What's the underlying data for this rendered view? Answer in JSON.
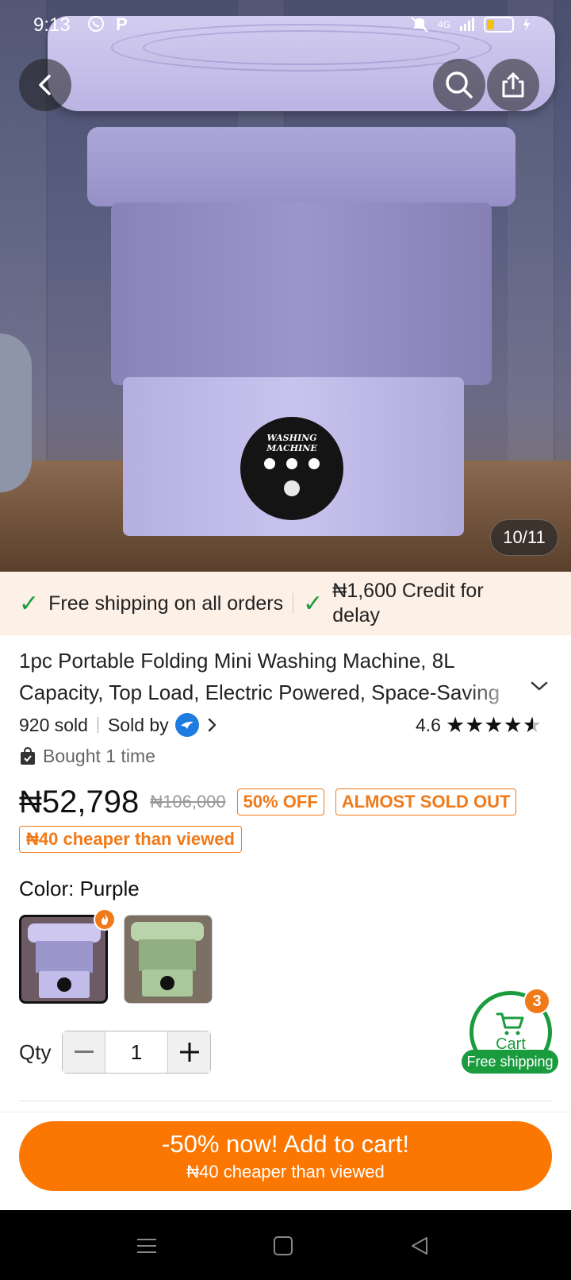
{
  "status_bar": {
    "time": "9:13",
    "app_indicator": "P",
    "network": "4G",
    "battery_level": 0.3,
    "battery_color": "#f4c20d"
  },
  "hero": {
    "image_counter": "10/11",
    "dial_text": "WASHING MACHINE",
    "icons": {
      "back": "back-arrow-icon",
      "search": "search-icon",
      "share": "share-icon"
    }
  },
  "promo": {
    "free_shipping": "Free shipping on all orders",
    "credit": "₦1,600 Credit for delay",
    "check_color": "#1a9c3e"
  },
  "product": {
    "title": "1pc Portable Folding Mini Washing Machine, 8L Capacity, Top Load, Electric Powered, Space-Saving",
    "sold": "920 sold",
    "sold_by": "Sold by",
    "rating": "4.6",
    "rating_value": 4.6,
    "bought": "Bought 1 time",
    "price": "₦52,798",
    "old_price": "₦106,000",
    "discount_tag": "50% OFF",
    "stock_tag": "ALMOST SOLD OUT",
    "cheaper_tag": "₦40 cheaper than viewed",
    "accent_color": "#f07a1a"
  },
  "color": {
    "label": "Color: Purple",
    "options": [
      {
        "name": "Purple",
        "selected": true,
        "tint": "#b9b3e6"
      },
      {
        "name": "Green",
        "selected": false,
        "tint": "#a9c99a"
      }
    ]
  },
  "quantity": {
    "label": "Qty",
    "value": "1"
  },
  "cart": {
    "label": "Cart",
    "count": "3",
    "free_shipping": "Free shipping",
    "color": "#1a9c3e"
  },
  "cta": {
    "main": "-50% now! Add to cart!",
    "sub": "₦40 cheaper than viewed",
    "color": "#fb7701"
  },
  "nav": {
    "icons": [
      "menu-icon",
      "home-icon",
      "back-triangle-icon"
    ]
  }
}
